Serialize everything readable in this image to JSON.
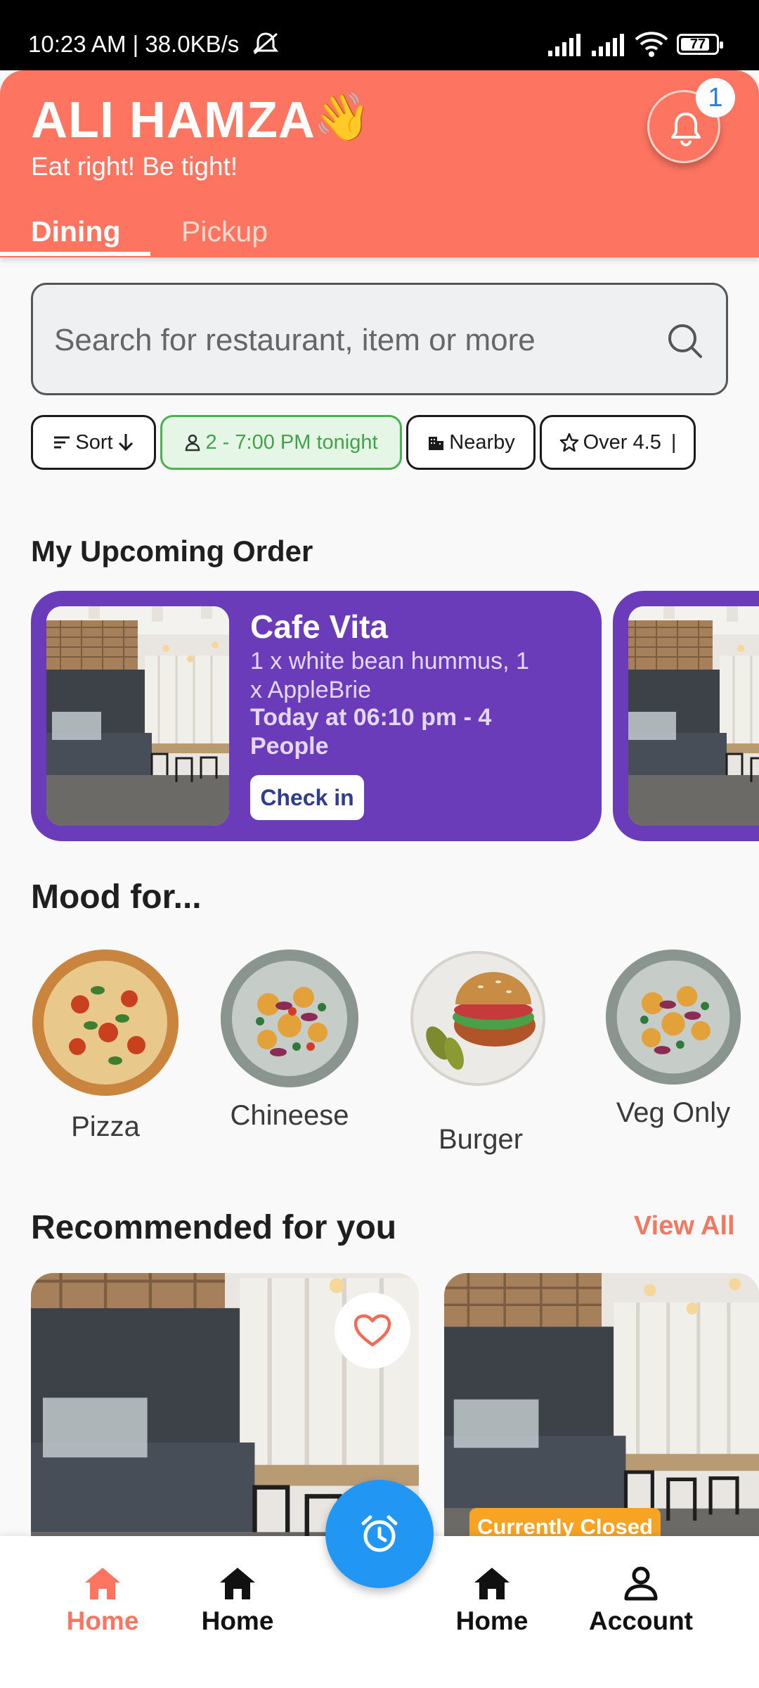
{
  "status_bar": {
    "time_speed": "10:23 AM | 38.0KB/s",
    "battery": "77"
  },
  "header": {
    "user_name": "ALI HAMZA",
    "wave_emoji": "👋",
    "tagline": "Eat right! Be tight!",
    "notification_count": "1",
    "tabs": [
      {
        "label": "Dining",
        "active": true
      },
      {
        "label": "Pickup",
        "active": false
      }
    ],
    "accent_color": "#fd7561"
  },
  "search": {
    "placeholder": "Search for restaurant, item or more",
    "value": ""
  },
  "filters": [
    {
      "label": "Sort",
      "icon": "sort-icon",
      "suffix_icon": "arrow-down-icon"
    },
    {
      "label": "2 - 7:00 PM tonight",
      "icon": "person-icon",
      "selected": true
    },
    {
      "label": "Nearby",
      "icon": "building-icon"
    },
    {
      "label": "Over 4.5",
      "icon": "star-icon"
    }
  ],
  "upcoming": {
    "heading": "My Upcoming Order",
    "orders": [
      {
        "restaurant": "Cafe Vita",
        "items": "1 x white bean hummus, 1 x AppleBrie",
        "when": "Today at 06:10 pm - 4 People",
        "action_label": "Check in"
      }
    ],
    "card_color": "#6b3cba"
  },
  "mood": {
    "heading": "Mood for...",
    "items": [
      {
        "label": "Pizza"
      },
      {
        "label": "Chineese"
      },
      {
        "label": "Burger"
      },
      {
        "label": "Veg Only"
      }
    ]
  },
  "recommended": {
    "heading": "Recommended for you",
    "view_all_label": "View All",
    "closed_badge": "Currently Closed"
  },
  "bottom_nav": {
    "items": [
      {
        "label": "Home",
        "icon": "home-icon",
        "active": true
      },
      {
        "label": "Home",
        "icon": "home-icon",
        "active": false
      },
      {
        "label": "Home",
        "icon": "home-icon",
        "active": false
      },
      {
        "label": "Account",
        "icon": "account-icon",
        "active": false
      }
    ],
    "fab_icon": "alarm-clock-icon",
    "fab_color": "#2196f3"
  }
}
